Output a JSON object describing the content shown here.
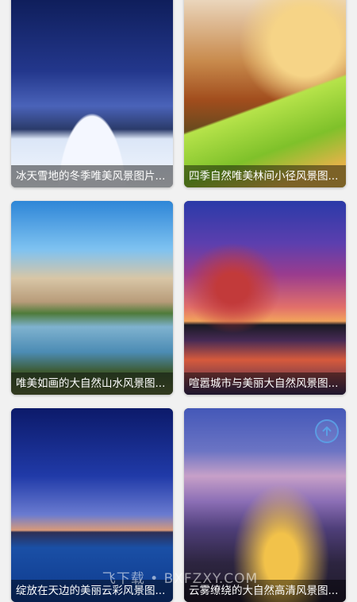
{
  "cards": [
    {
      "caption": "冰天雪地的冬季唯美风景图片..."
    },
    {
      "caption": "四季自然唯美林间小径风景图..."
    },
    {
      "caption": "唯美如画的大自然山水风景图..."
    },
    {
      "caption": "喧嚣城市与美丽大自然风景图..."
    },
    {
      "caption": "绽放在天边的美丽云彩风景图..."
    },
    {
      "caption": "云雾缭绕的大自然高清风景图..."
    }
  ],
  "scroll_top_icon": "arrow-up-circle-icon",
  "watermark": "飞下载 • BXFZXY.COM",
  "colors": {
    "caption_bg": "#000000",
    "page_bg": "#f1f1f1",
    "fab": "#5aa0e6"
  }
}
